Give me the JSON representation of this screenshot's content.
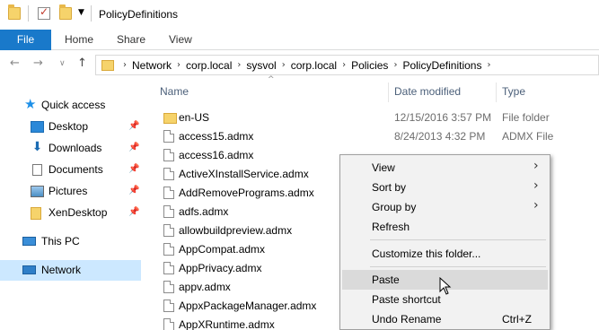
{
  "window": {
    "title": "PolicyDefinitions"
  },
  "ribbon": {
    "tabs": [
      {
        "label": "File"
      },
      {
        "label": "Home"
      },
      {
        "label": "Share"
      },
      {
        "label": "View"
      }
    ]
  },
  "address": {
    "crumbs": [
      "Network",
      "corp.local",
      "sysvol",
      "corp.local",
      "Policies",
      "PolicyDefinitions"
    ]
  },
  "navpane": {
    "items": [
      {
        "label": "Quick access",
        "icon": "star-icon"
      },
      {
        "label": "Desktop",
        "icon": "desktop-icon",
        "pinned": true
      },
      {
        "label": "Downloads",
        "icon": "download-icon",
        "pinned": true
      },
      {
        "label": "Documents",
        "icon": "documents-icon",
        "pinned": true
      },
      {
        "label": "Pictures",
        "icon": "pictures-icon",
        "pinned": true
      },
      {
        "label": "XenDesktop",
        "icon": "folder-icon",
        "pinned": true
      },
      {
        "label": "This PC",
        "icon": "computer-icon"
      },
      {
        "label": "Network",
        "icon": "network-icon",
        "selected": true
      }
    ]
  },
  "columns": {
    "name": "Name",
    "date": "Date modified",
    "type": "Type"
  },
  "files": [
    {
      "name": "en-US",
      "date": "12/15/2016 3:57 PM",
      "type": "File folder",
      "icon": "folder-icon"
    },
    {
      "name": "access15.admx",
      "date": "8/24/2013 4:32 PM",
      "type": "ADMX File",
      "icon": "file-icon"
    },
    {
      "name": "access16.admx",
      "date": "",
      "type": "",
      "icon": "file-icon"
    },
    {
      "name": "ActiveXInstallService.admx",
      "date": "",
      "type": "",
      "icon": "file-icon"
    },
    {
      "name": "AddRemovePrograms.admx",
      "date": "",
      "type": "",
      "icon": "file-icon"
    },
    {
      "name": "adfs.admx",
      "date": "",
      "type": "",
      "icon": "file-icon"
    },
    {
      "name": "allowbuildpreview.admx",
      "date": "",
      "type": "",
      "icon": "file-icon"
    },
    {
      "name": "AppCompat.admx",
      "date": "",
      "type": "",
      "icon": "file-icon"
    },
    {
      "name": "AppPrivacy.admx",
      "date": "",
      "type": "",
      "icon": "file-icon"
    },
    {
      "name": "appv.admx",
      "date": "",
      "type": "",
      "icon": "file-icon"
    },
    {
      "name": "AppxPackageManager.admx",
      "date": "",
      "type": "",
      "icon": "file-icon"
    },
    {
      "name": "AppXRuntime.admx",
      "date": "",
      "type": "",
      "icon": "file-icon"
    }
  ],
  "context_menu": {
    "items": [
      {
        "label": "View",
        "submenu": true
      },
      {
        "label": "Sort by",
        "submenu": true
      },
      {
        "label": "Group by",
        "submenu": true
      },
      {
        "label": "Refresh"
      },
      {
        "label": "Customize this folder..."
      },
      {
        "label": "Paste",
        "hover": true
      },
      {
        "label": "Paste shortcut"
      },
      {
        "label": "Undo Rename",
        "shortcut": "Ctrl+Z"
      }
    ]
  },
  "colors": {
    "accent": "#1979ca",
    "selection": "#cce8ff",
    "menu_bg": "#f2f2f2"
  }
}
